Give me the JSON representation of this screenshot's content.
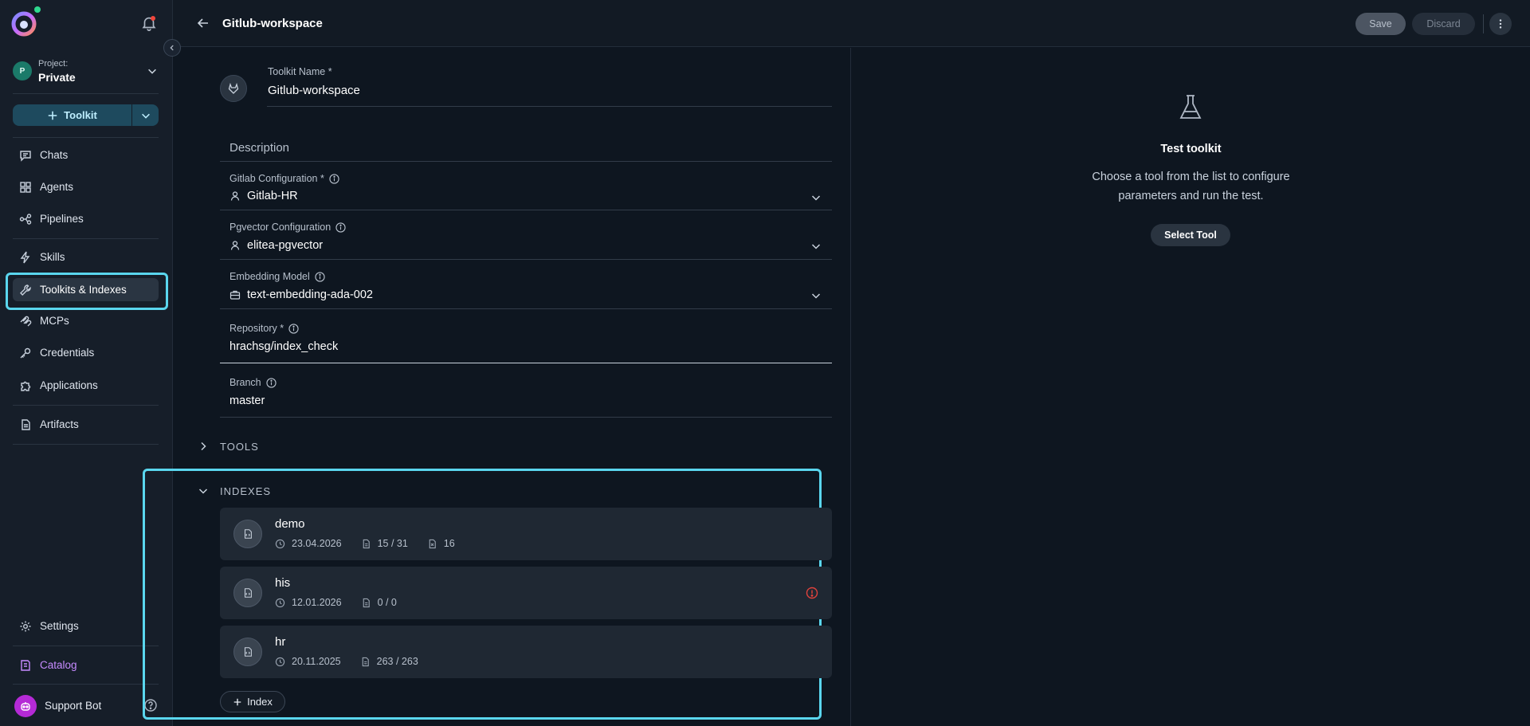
{
  "sidebar": {
    "project_label": "Project:",
    "project_name": "Private",
    "project_initial": "P",
    "toolkit_button": "Toolkit",
    "nav": {
      "chats": "Chats",
      "agents": "Agents",
      "pipelines": "Pipelines",
      "skills": "Skills",
      "toolkits": "Toolkits & Indexes",
      "mcps": "MCPs",
      "credentials": "Credentials",
      "applications": "Applications",
      "artifacts": "Artifacts",
      "settings": "Settings",
      "catalog": "Catalog"
    },
    "support_bot": "Support Bot"
  },
  "header": {
    "title": "Gitlub-workspace",
    "save_label": "Save",
    "discard_label": "Discard"
  },
  "form": {
    "toolkit_name_label": "Toolkit Name *",
    "toolkit_name_value": "Gitlub-workspace",
    "description_label": "Description",
    "gitlab_config_label": "Gitlab Configuration *",
    "gitlab_config_value": "Gitlab-HR",
    "pgvector_label": "Pgvector Configuration",
    "pgvector_value": "elitea-pgvector",
    "embedding_label": "Embedding Model",
    "embedding_value": "text-embedding-ada-002",
    "repository_label": "Repository *",
    "repository_value": "hrachsg/index_check",
    "branch_label": "Branch",
    "branch_value": "master",
    "tools_section": "TOOLS",
    "indexes_section": "INDEXES",
    "indexes": [
      {
        "name": "demo",
        "date": "23.04.2026",
        "docs": "15 / 31",
        "extra": "16",
        "warning": false
      },
      {
        "name": "his",
        "date": "12.01.2026",
        "docs": "0 / 0",
        "warning": true
      },
      {
        "name": "hr",
        "date": "20.11.2025",
        "docs": "263 / 263",
        "warning": false
      }
    ],
    "add_index_label": "Index"
  },
  "test_panel": {
    "title": "Test toolkit",
    "description": "Choose a tool from the list to configure parameters and run the test.",
    "select_tool_label": "Select Tool"
  },
  "colors": {
    "accent_highlight": "#5ad6ee",
    "catalog": "#c68bff",
    "warning": "#e0423c",
    "status_online": "#2fd88e"
  }
}
